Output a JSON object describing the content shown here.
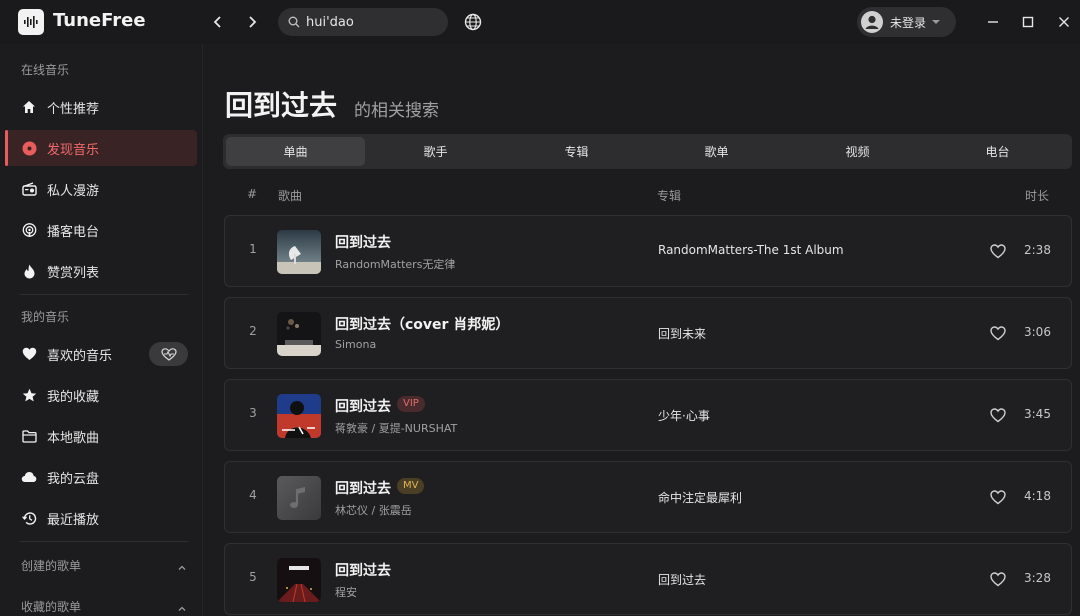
{
  "app": {
    "title": "TuneFree"
  },
  "search": {
    "value": "hui'dao"
  },
  "user": {
    "label": "未登录"
  },
  "sidebar": {
    "section_online": "在线音乐",
    "online_items": [
      {
        "label": "个性推荐",
        "icon": "home-icon"
      },
      {
        "label": "发现音乐",
        "icon": "disc-icon"
      },
      {
        "label": "私人漫游",
        "icon": "radio-icon"
      },
      {
        "label": "播客电台",
        "icon": "podcast-icon"
      },
      {
        "label": "赞赏列表",
        "icon": "flame-icon"
      }
    ],
    "section_mine": "我的音乐",
    "mine_items": [
      {
        "label": "喜欢的音乐",
        "icon": "heart-icon"
      },
      {
        "label": "我的收藏",
        "icon": "star-icon"
      },
      {
        "label": "本地歌曲",
        "icon": "folder-icon"
      },
      {
        "label": "我的云盘",
        "icon": "cloud-icon"
      },
      {
        "label": "最近播放",
        "icon": "history-icon"
      }
    ],
    "section_created": "创建的歌单",
    "section_collected": "收藏的歌单"
  },
  "main": {
    "title": "回到过去",
    "subtitle": "的相关搜索",
    "tabs": [
      "单曲",
      "歌手",
      "专辑",
      "歌单",
      "视频",
      "电台"
    ],
    "columns": {
      "num": "#",
      "song": "歌曲",
      "album": "专辑",
      "duration": "时长"
    },
    "songs": [
      {
        "num": "1",
        "title": "回到过去",
        "artist": "RandomMatters无定律",
        "album": "RandomMatters-The 1st Album",
        "duration": "2:38",
        "badge": ""
      },
      {
        "num": "2",
        "title": "回到过去（cover 肖邦妮）",
        "artist": "Simona",
        "album": "回到未来",
        "duration": "3:06",
        "badge": ""
      },
      {
        "num": "3",
        "title": "回到过去",
        "artist": "蒋敦豪 / 夏提-NURSHAT",
        "album": "少年·心事",
        "duration": "3:45",
        "badge": "VIP"
      },
      {
        "num": "4",
        "title": "回到过去",
        "artist": "林芯仪 / 张震岳",
        "album": "命中注定最犀利",
        "duration": "4:18",
        "badge": "MV"
      },
      {
        "num": "5",
        "title": "回到过去",
        "artist": "程安",
        "album": "回到过去",
        "duration": "3:28",
        "badge": ""
      }
    ]
  },
  "colors": {
    "accent": "#e85c5c",
    "active_bg": "#3a2325",
    "bg": "#1c1c1e"
  }
}
